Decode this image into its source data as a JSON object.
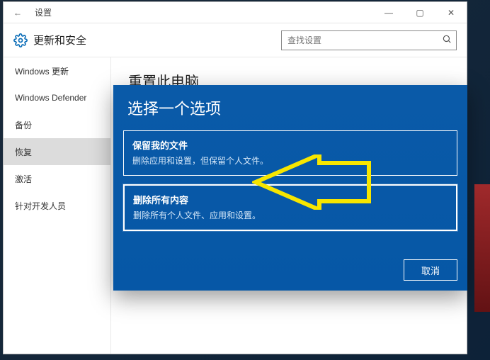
{
  "window": {
    "title": "设置",
    "controls": {
      "minimize": "—",
      "maximize": "▢",
      "close": "✕"
    },
    "back_icon": "←"
  },
  "header": {
    "section_title": "更新和安全",
    "search_placeholder": "查找设置",
    "search_icon": "magnifier"
  },
  "sidebar": {
    "items": [
      {
        "label": "Windows 更新",
        "selected": false
      },
      {
        "label": "Windows Defender",
        "selected": false
      },
      {
        "label": "备份",
        "selected": false
      },
      {
        "label": "恢复",
        "selected": true
      },
      {
        "label": "激活",
        "selected": false
      },
      {
        "label": "针对开发人员",
        "selected": false
      }
    ]
  },
  "main": {
    "page_title": "重置此电脑"
  },
  "dialog": {
    "title": "选择一个选项",
    "options": [
      {
        "title": "保留我的文件",
        "desc": "删除应用和设置，但保留个人文件。"
      },
      {
        "title": "删除所有内容",
        "desc": "删除所有个人文件、应用和设置。"
      }
    ],
    "cancel_label": "取消"
  }
}
